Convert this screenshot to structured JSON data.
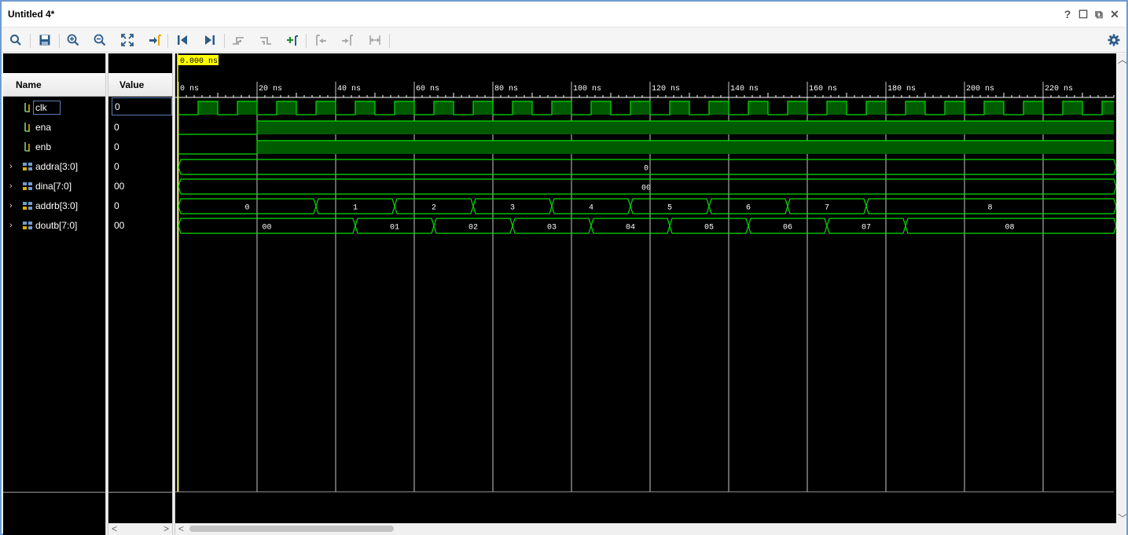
{
  "window": {
    "title": "Untitled 4*",
    "controls": {
      "help": "?",
      "maximize": "☐",
      "float": "⧉",
      "close": "✕"
    }
  },
  "toolbar": {
    "buttons": [
      "search-icon",
      "save-icon",
      "zoom-in-icon",
      "zoom-out-icon",
      "zoom-fit-icon",
      "go-to-cursor-icon",
      "go-to-time-zero-icon",
      "go-to-last-time-icon",
      "previous-transition-icon",
      "next-transition-icon",
      "add-marker-icon",
      "previous-marker-icon",
      "next-marker-icon",
      "swap-cursors-icon"
    ],
    "settings_icon": "gear-icon"
  },
  "columns": {
    "name": "Name",
    "value": "Value"
  },
  "signals": [
    {
      "name": "clk",
      "value": "0",
      "kind": "bit",
      "expandable": false,
      "selected": true
    },
    {
      "name": "ena",
      "value": "0",
      "kind": "bit",
      "expandable": false,
      "selected": false
    },
    {
      "name": "enb",
      "value": "0",
      "kind": "bit",
      "expandable": false,
      "selected": false
    },
    {
      "name": "addra[3:0]",
      "value": "0",
      "kind": "bus",
      "expandable": true,
      "selected": false
    },
    {
      "name": "dina[7:0]",
      "value": "00",
      "kind": "bus",
      "expandable": true,
      "selected": false
    },
    {
      "name": "addrb[3:0]",
      "value": "0",
      "kind": "bus",
      "expandable": true,
      "selected": false
    },
    {
      "name": "doutb[7:0]",
      "value": "00",
      "kind": "bus",
      "expandable": true,
      "selected": false
    }
  ],
  "waveform": {
    "cursor_label": "0.000 ns",
    "time_unit": "ns",
    "ruler_labels": [
      "0 ns",
      "20 ns",
      "40 ns",
      "60 ns",
      "80 ns",
      "100 ns",
      "120 ns",
      "140 ns",
      "160 ns",
      "180 ns",
      "200 ns",
      "220 ns"
    ],
    "ruler_times": [
      0,
      20,
      40,
      60,
      80,
      100,
      120,
      140,
      160,
      180,
      200,
      220
    ],
    "visible_range_ns": [
      0,
      238
    ],
    "clk": {
      "period_ns": 10,
      "first_rise_ns": 5
    },
    "ena": {
      "rise_ns": 20
    },
    "enb": {
      "rise_ns": 20
    },
    "addra": [
      {
        "start": 0,
        "label": "0"
      }
    ],
    "dina": [
      {
        "start": 0,
        "label": "00"
      }
    ],
    "addrb": [
      {
        "start": 0,
        "label": "0"
      },
      {
        "start": 35,
        "label": "1"
      },
      {
        "start": 55,
        "label": "2"
      },
      {
        "start": 75,
        "label": "3"
      },
      {
        "start": 95,
        "label": "4"
      },
      {
        "start": 115,
        "label": "5"
      },
      {
        "start": 135,
        "label": "6"
      },
      {
        "start": 155,
        "label": "7"
      },
      {
        "start": 175,
        "label": "8"
      }
    ],
    "doutb": [
      {
        "start": 0,
        "label": "00"
      },
      {
        "start": 45,
        "label": "01"
      },
      {
        "start": 65,
        "label": "02"
      },
      {
        "start": 85,
        "label": "03"
      },
      {
        "start": 105,
        "label": "04"
      },
      {
        "start": 125,
        "label": "05"
      },
      {
        "start": 145,
        "label": "06"
      },
      {
        "start": 165,
        "label": "07"
      },
      {
        "start": 185,
        "label": "08"
      }
    ],
    "colors": {
      "wave": "#00e000",
      "fill": "#005a00",
      "cursor": "#ffff00",
      "grid": "#c8c8c8",
      "ruler_text": "#ffffff"
    }
  }
}
